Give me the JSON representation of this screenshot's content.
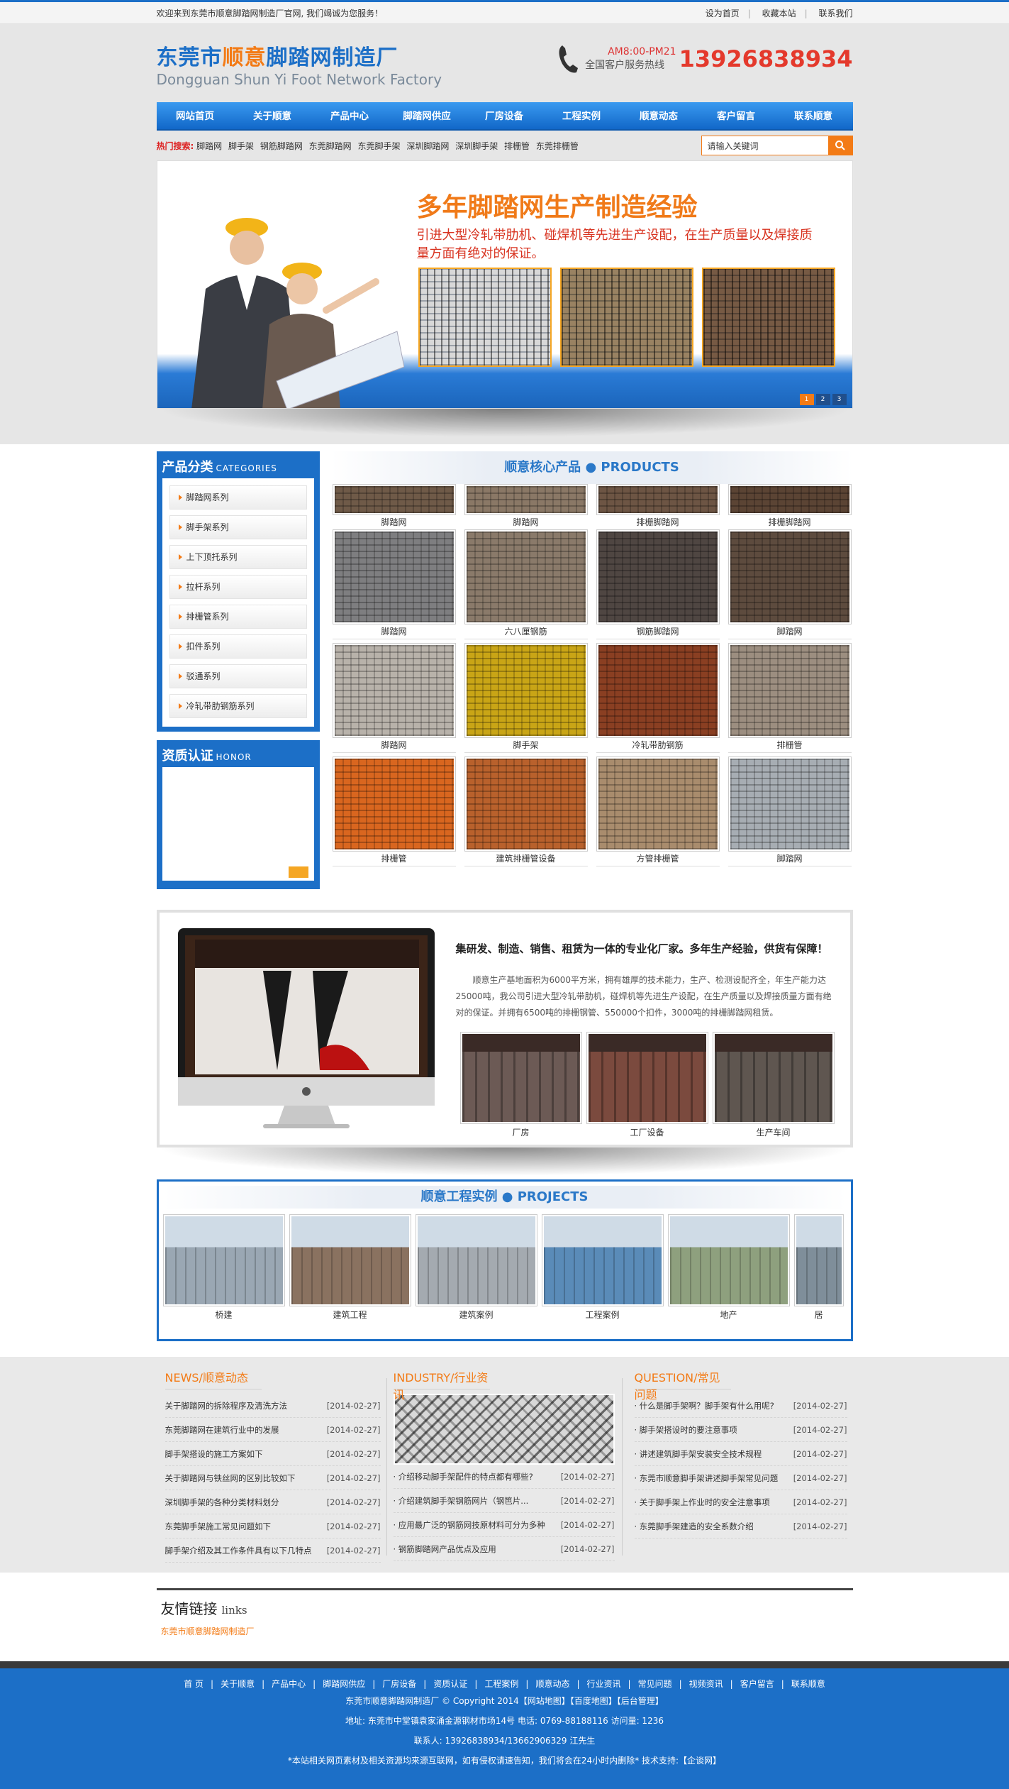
{
  "topbar": {
    "welcome": "欢迎来到东莞市顺意脚踏网制造厂官网, 我们竭诚为您服务！",
    "links": [
      "设为首页",
      "收藏本站",
      "联系我们"
    ]
  },
  "header": {
    "logo_cn_a": "东莞市",
    "logo_cn_b": "顺意",
    "logo_cn_c": "脚踏网制造厂",
    "logo_en": "Dongguan Shun Yi Foot Network Factory",
    "hours": "AM8:00-PM21",
    "hotline_label": "全国客户服务热线",
    "hotline": "13926838934"
  },
  "nav": [
    "网站首页",
    "关于顺意",
    "产品中心",
    "脚踏网供应",
    "厂房设备",
    "工程实例",
    "顺意动态",
    "客户留言",
    "联系顺意"
  ],
  "search": {
    "hot_label": "热门搜索:",
    "hot": [
      "脚踏网",
      "脚手架",
      "钢筋脚踏网",
      "东莞脚踏网",
      "东莞脚手架",
      "深圳脚踏网",
      "深圳脚手架",
      "排栅管",
      "东莞排栅管"
    ],
    "placeholder": "请输入关键词"
  },
  "banner": {
    "title": "多年脚踏网生产制造经验",
    "subtitle": "引进大型冷轧带肋机、碰焊机等先进生产设配，在生产质量以及焊接质量方面有绝对的保证。",
    "dots": [
      "1",
      "2",
      "3"
    ]
  },
  "sidebar": {
    "cat_title": "产品分类",
    "cat_en": "CATEGORIES",
    "categories": [
      "脚踏网系列",
      "脚手架系列",
      "上下顶托系列",
      "拉杆系列",
      "排栅管系列",
      "扣件系列",
      "驳通系列",
      "冷轧带肋钢筋系列"
    ],
    "honor_title": "资质认证",
    "honor_en": "HONOR"
  },
  "products": {
    "title": "顺意核心产品 ● PRODUCTS",
    "items": [
      {
        "label": "脚踏网",
        "color": "#6f5a48"
      },
      {
        "label": "脚踏网",
        "color": "#8a7866"
      },
      {
        "label": "排栅脚踏网",
        "color": "#6d5544"
      },
      {
        "label": "排栅脚踏网",
        "color": "#5b4434"
      },
      {
        "label": "脚踏网",
        "color": "#7e7e80"
      },
      {
        "label": "六八厘钢筋",
        "color": "#8a7a6a"
      },
      {
        "label": "钢筋脚踏网",
        "color": "#4f4642"
      },
      {
        "label": "脚踏网",
        "color": "#5d4b3e"
      },
      {
        "label": "脚踏网",
        "color": "#b8b2aa"
      },
      {
        "label": "脚手架",
        "color": "#c9a516"
      },
      {
        "label": "冷轧带肋钢筋",
        "color": "#8a3f22"
      },
      {
        "label": "排栅管",
        "color": "#9c8e80"
      },
      {
        "label": "排栅管",
        "color": "#d9661f"
      },
      {
        "label": "建筑排栅管设备",
        "color": "#b9612c"
      },
      {
        "label": "方管排栅管",
        "color": "#a98c6d"
      },
      {
        "label": "脚踏网",
        "color": "#a7adb3"
      }
    ]
  },
  "about": {
    "headline": "集研发、制造、销售、租赁为一体的专业化厂家。多年生产经验，供货有保障！",
    "text": "顺意生产基地面积为6000平方米，拥有雄厚的技术能力，生产、检测设配齐全，年生产能力达25000吨，我公司引进大型冷轧带肋机，碰焊机等先进生产设配，在生产质量以及焊接质量方面有绝对的保证。并拥有6500吨的排栅钢管、550000个扣件，3000吨的排栅脚踏网租赁。",
    "photos": [
      {
        "label": "厂房",
        "color": "#6c5a55"
      },
      {
        "label": "工厂设备",
        "color": "#7b4a3e"
      },
      {
        "label": "生产车间",
        "color": "#5f5650"
      }
    ]
  },
  "projects": {
    "title": "顺意工程实例 ● PROJECTS",
    "items": [
      {
        "label": "桥建",
        "color": "#9aa7b3"
      },
      {
        "label": "建筑工程",
        "color": "#8a7260"
      },
      {
        "label": "建筑案例",
        "color": "#a4aab0"
      },
      {
        "label": "工程案例",
        "color": "#5a8bb8"
      },
      {
        "label": "地产",
        "color": "#8ea07e"
      },
      {
        "label": "居",
        "color": "#7f8e9a"
      }
    ]
  },
  "news": {
    "title": "NEWS/顺意动态",
    "items": [
      {
        "t": "关于脚踏网的拆除程序及清洗方法",
        "d": "[2014-02-27]"
      },
      {
        "t": "东莞脚踏网在建筑行业中的发展",
        "d": "[2014-02-27]"
      },
      {
        "t": "脚手架搭设的施工方案如下",
        "d": "[2014-02-27]"
      },
      {
        "t": "关于脚踏网与铁丝网的区别比较如下",
        "d": "[2014-02-27]"
      },
      {
        "t": "深圳脚手架的各种分类材料划分",
        "d": "[2014-02-27]"
      },
      {
        "t": "东莞脚手架施工常见问题如下",
        "d": "[2014-02-27]"
      },
      {
        "t": "脚手架介绍及其工作条件具有以下几特点",
        "d": "[2014-02-27]"
      }
    ]
  },
  "industry": {
    "title": "INDUSTRY/行业资讯",
    "items": [
      {
        "t": "· 介绍移动脚手架配件的特点都有哪些?",
        "d": "[2014-02-27]"
      },
      {
        "t": "· 介绍建筑脚手架钢筋网片（钢笆片...",
        "d": "[2014-02-27]"
      },
      {
        "t": "· 应用最广泛的钢筋网技原材料可分为多种",
        "d": "[2014-02-27]"
      },
      {
        "t": "· 钢筋脚踏网产品优点及应用",
        "d": "[2014-02-27]"
      }
    ]
  },
  "question": {
    "title": "QUESTION/常见问题",
    "items": [
      {
        "t": "· 什么是脚手架啊？脚手架有什么用呢?",
        "d": "[2014-02-27]"
      },
      {
        "t": "· 脚手架搭设时的要注意事项",
        "d": "[2014-02-27]"
      },
      {
        "t": "· 讲述建筑脚手架安装安全技术规程",
        "d": "[2014-02-27]"
      },
      {
        "t": "· 东莞市顺意脚手架讲述脚手架常见问题",
        "d": "[2014-02-27]"
      },
      {
        "t": "· 关于脚手架上作业时的安全注意事项",
        "d": "[2014-02-27]"
      },
      {
        "t": "· 东莞脚手架建造的安全系数介绍",
        "d": "[2014-02-27]"
      }
    ]
  },
  "links": {
    "title": "友情链接",
    "title_en": "links",
    "items": [
      "东莞市顺意脚踏网制造厂"
    ]
  },
  "footer": {
    "nav": [
      "首 页",
      "关于顺意",
      "产品中心",
      "脚踏网供应",
      "厂房设备",
      "资质认证",
      "工程案例",
      "顺意动态",
      "行业资讯",
      "常见问题",
      "视频资讯",
      "客户留言",
      "联系顺意"
    ],
    "copyright": "东莞市顺意脚踏网制造厂  © Copyright 2014【网站地图】【百度地图】【后台管理】",
    "address": "地址: 东莞市中堂镇袁家涌金源钢材市场14号 电话: 0769-88188116   访问量: 1236",
    "contact": "联系人: 13926838934/13662906329 江先生",
    "notice": "*本站相关网页素材及相关资源均来源互联网，如有侵权请速告知，我们将会在24小时内删除* 技术支持:【企谈网】"
  }
}
